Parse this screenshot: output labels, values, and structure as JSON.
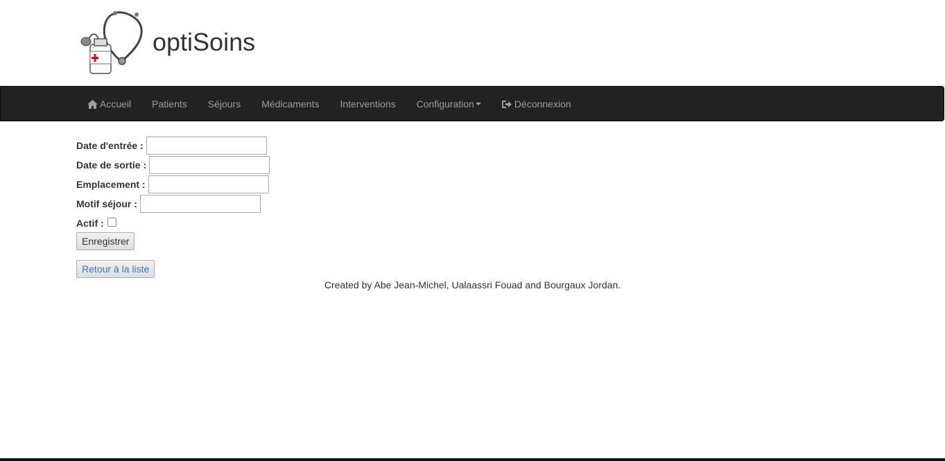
{
  "header": {
    "brand": "optiSoins",
    "logo_icon": "stethoscope-medicine-bottle-icon"
  },
  "nav": {
    "items": [
      {
        "label": "Accueil",
        "icon": "home-icon"
      },
      {
        "label": "Patients"
      },
      {
        "label": "Séjours"
      },
      {
        "label": "Médicaments"
      },
      {
        "label": "Interventions"
      },
      {
        "label": "Configuration",
        "icon": "caret-down-icon"
      },
      {
        "label": "Déconnexion",
        "icon": "logout-icon"
      }
    ]
  },
  "form": {
    "date_entree_label": "Date d'entrée :",
    "date_entree_value": "",
    "date_sortie_label": "Date de sortie :",
    "date_sortie_value": "",
    "emplacement_label": "Emplacement :",
    "emplacement_value": "",
    "motif_label": "Motif séjour :",
    "motif_value": "",
    "actif_label": "Actif :",
    "actif_checked": false,
    "save_label": "Enregistrer"
  },
  "back_link_label": "Retour à la liste",
  "footer": {
    "text": "Created by Abe Jean-Michel, Ualaassri Fouad and Bourgaux Jordan."
  },
  "colors": {
    "navbar_bg": "#222222",
    "nav_text": "#9d9d9d",
    "link": "#337ab7"
  }
}
